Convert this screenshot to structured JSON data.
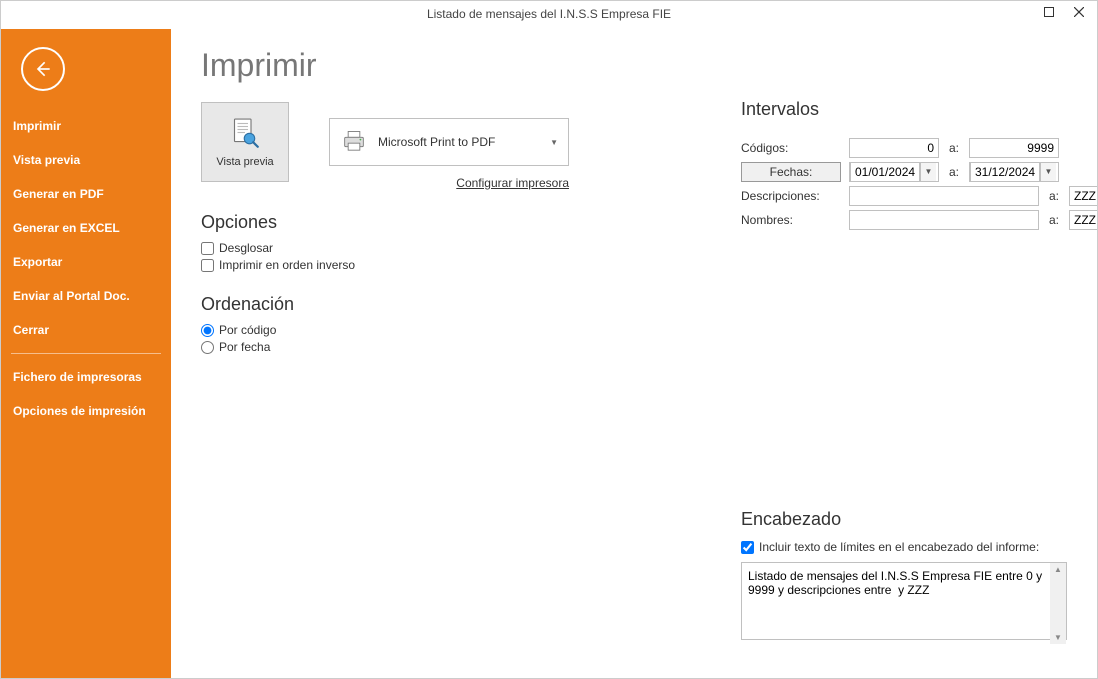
{
  "window": {
    "title": "Listado de mensajes del I.N.S.S Empresa FIE"
  },
  "sidebar": {
    "items": [
      "Imprimir",
      "Vista previa",
      "Generar en PDF",
      "Generar en EXCEL",
      "Exportar",
      "Enviar al Portal Doc.",
      "Cerrar"
    ],
    "items2": [
      "Fichero de impresoras",
      "Opciones de impresión"
    ]
  },
  "main": {
    "title": "Imprimir",
    "preview_label": "Vista previa",
    "printer_name": "Microsoft Print to PDF",
    "configure_printer": "Configurar impresora"
  },
  "opciones": {
    "title": "Opciones",
    "desglosar": "Desglosar",
    "inverso": "Imprimir en orden inverso"
  },
  "ordenacion": {
    "title": "Ordenación",
    "por_codigo": "Por código",
    "por_fecha": "Por fecha"
  },
  "intervalos": {
    "title": "Intervalos",
    "codigos_label": "Códigos:",
    "codigos_from": "0",
    "codigos_to": "9999",
    "fechas_label": "Fechas:",
    "fecha_from": "01/01/2024",
    "fecha_to": "31/12/2024",
    "desc_label": "Descripciones:",
    "desc_from": "",
    "desc_to": "ZZZ",
    "nombres_label": "Nombres:",
    "nombres_from": "",
    "nombres_to": "ZZZ",
    "a": "a:"
  },
  "encabezado": {
    "title": "Encabezado",
    "include_label": "Incluir texto de límites en el encabezado del informe:",
    "text": "Listado de mensajes del I.N.S.S Empresa FIE entre 0 y 9999 y descripciones entre  y ZZZ"
  }
}
